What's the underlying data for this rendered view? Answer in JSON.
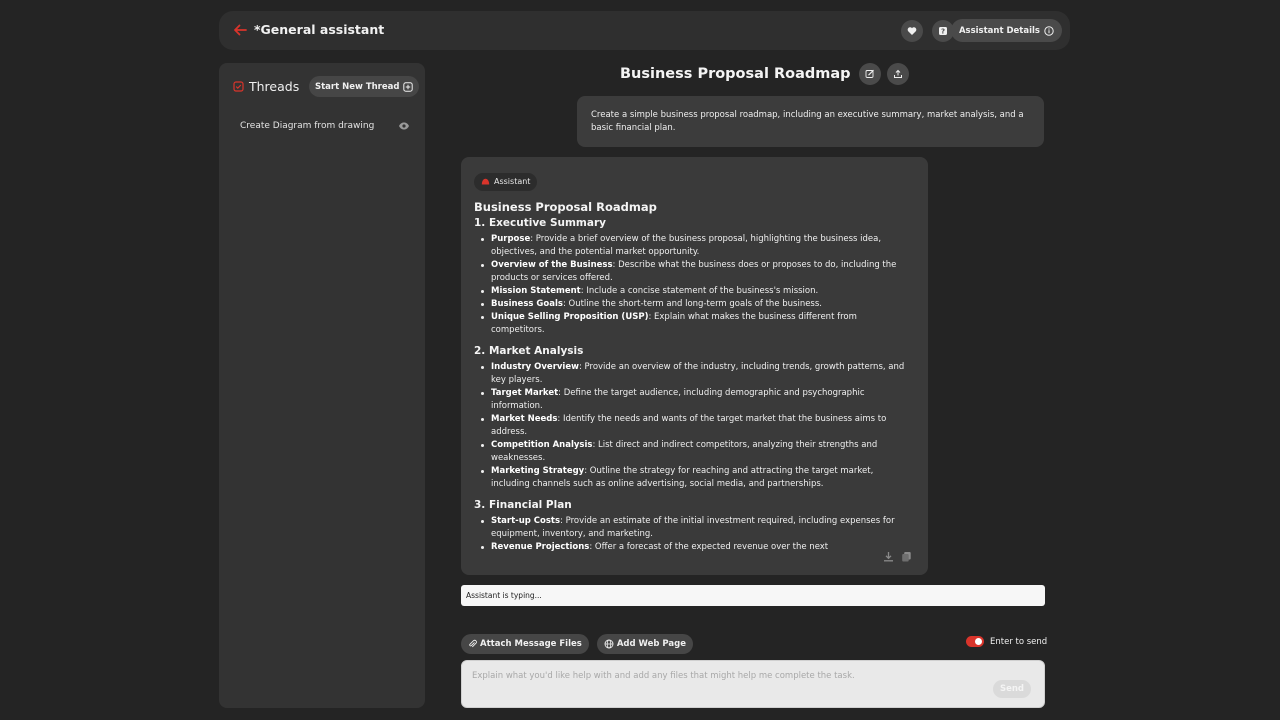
{
  "header": {
    "title": "*General assistant",
    "details_label": "Assistant Details",
    "accent": "#d9342b"
  },
  "sidebar": {
    "title": "Threads",
    "new_thread_label": "Start New Thread",
    "threads": [
      {
        "label": "Create Diagram from drawing"
      }
    ]
  },
  "chat": {
    "title": "Business Proposal Roadmap",
    "user_message": "Create a simple business proposal roadmap, including an executive summary, market analysis, and a basic financial plan.",
    "assistant": {
      "badge": "Assistant",
      "heading": "Business Proposal Roadmap",
      "sections": [
        {
          "title": "1. Executive Summary",
          "items": [
            {
              "bold": "Purpose",
              "text": ": Provide a brief overview of the business proposal, highlighting the business idea, objectives, and the potential market opportunity."
            },
            {
              "bold": "Overview of the Business",
              "text": ": Describe what the business does or proposes to do, including the products or services offered."
            },
            {
              "bold": "Mission Statement",
              "text": ": Include a concise statement of the business's mission."
            },
            {
              "bold": "Business Goals",
              "text": ": Outline the short-term and long-term goals of the business."
            },
            {
              "bold": "Unique Selling Proposition (USP)",
              "text": ": Explain what makes the business different from competitors."
            }
          ]
        },
        {
          "title": "2. Market Analysis",
          "items": [
            {
              "bold": "Industry Overview",
              "text": ": Provide an overview of the industry, including trends, growth patterns, and key players."
            },
            {
              "bold": "Target Market",
              "text": ": Define the target audience, including demographic and psychographic information."
            },
            {
              "bold": "Market Needs",
              "text": ": Identify the needs and wants of the target market that the business aims to address."
            },
            {
              "bold": "Competition Analysis",
              "text": ": List direct and indirect competitors, analyzing their strengths and weaknesses."
            },
            {
              "bold": "Marketing Strategy",
              "text": ": Outline the strategy for reaching and attracting the target market, including channels such as online advertising, social media, and partnerships."
            }
          ]
        },
        {
          "title": "3. Financial Plan",
          "items": [
            {
              "bold": "Start-up Costs",
              "text": ": Provide an estimate of the initial investment required, including expenses for equipment, inventory, and marketing."
            },
            {
              "bold": "Revenue Projections",
              "text": ": Offer a forecast of the expected revenue over the next"
            }
          ]
        }
      ]
    },
    "typing_status": "Assistant is typing..."
  },
  "composer": {
    "attach_label": "Attach Message Files",
    "web_page_label": "Add Web Page",
    "enter_to_send_label": "Enter to send",
    "enter_to_send_on": true,
    "placeholder": "Explain what you'd like help with and add any files that might help me complete the task.",
    "send_label": "Send"
  }
}
